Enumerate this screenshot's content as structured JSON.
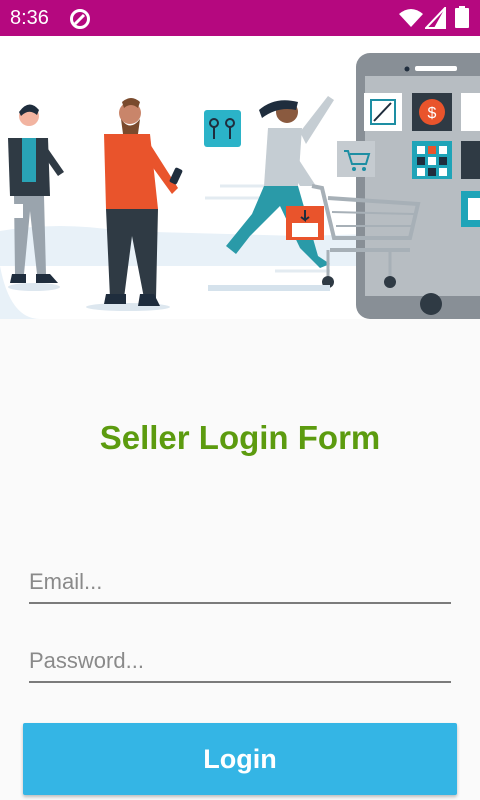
{
  "status_bar": {
    "time": "8:36",
    "background_color": "#b5087f",
    "icons": [
      "data-saver-icon",
      "wifi-icon",
      "cellular-signal-icon",
      "battery-icon"
    ]
  },
  "hero": {
    "illustration": "shopping-people-with-phone-illustration"
  },
  "form": {
    "title": "Seller Login Form",
    "title_color": "#5c9b0f",
    "email_placeholder": "Email...",
    "password_placeholder": "Password...",
    "login_label": "Login",
    "button_color": "#34b5e5"
  }
}
